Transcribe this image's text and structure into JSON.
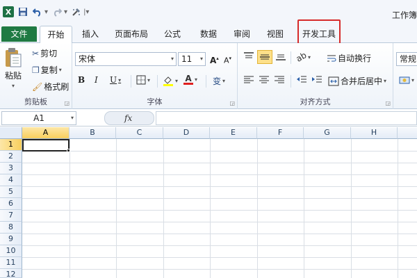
{
  "window": {
    "title": "工作簿",
    "app_icon": "excel-logo",
    "app_icon_letter": "X",
    "quick_access": [
      "save-icon",
      "undo-icon",
      "redo-icon",
      "format-painter-icon",
      "customize-icon"
    ]
  },
  "tabs": [
    {
      "label": "文件",
      "kind": "file"
    },
    {
      "label": "开始",
      "kind": "active"
    },
    {
      "label": "插入"
    },
    {
      "label": "页面布局"
    },
    {
      "label": "公式"
    },
    {
      "label": "数据"
    },
    {
      "label": "审阅"
    },
    {
      "label": "视图"
    },
    {
      "label": "开发工具",
      "highlighted": true
    }
  ],
  "highlight_color": "#d62a2a",
  "file_tab_color": "#1f7a43",
  "ribbon": {
    "clipboard": {
      "label": "剪贴板",
      "paste": "粘贴",
      "cut": "剪切",
      "copy": "复制",
      "format_painter": "格式刷"
    },
    "font": {
      "label": "字体",
      "font_name": "宋体",
      "font_size": "11",
      "bold": "B",
      "italic": "I",
      "underline": "U",
      "font_color_letter": "A",
      "wen": "变"
    },
    "alignment": {
      "label": "对齐方式",
      "wrap": "自动换行",
      "merge": "合并后居中"
    },
    "number": {
      "format": "常规"
    }
  },
  "formula_bar": {
    "name_box": "A1",
    "fx": "fx",
    "value": ""
  },
  "grid": {
    "columns": [
      "A",
      "B",
      "C",
      "D",
      "E",
      "F",
      "G",
      "H"
    ],
    "rows": [
      "1",
      "2",
      "3",
      "4",
      "5",
      "6",
      "7",
      "8",
      "9",
      "10",
      "11",
      "12"
    ],
    "selected_cell": "A1",
    "selection_color": "#f8cf5d"
  }
}
